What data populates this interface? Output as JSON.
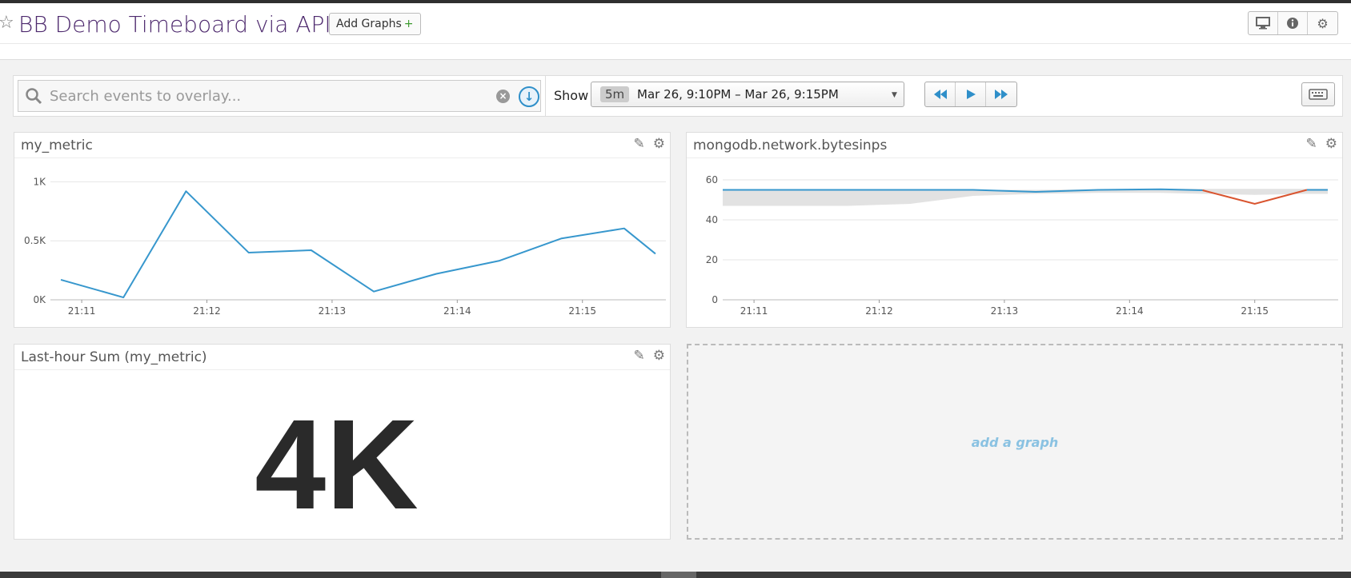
{
  "header": {
    "title": "BB Demo Timeboard via API",
    "add_graphs_label": "Add Graphs",
    "add_graphs_plus": "+",
    "icons": [
      "monitor-icon",
      "info-icon",
      "gear-icon"
    ]
  },
  "toolbar": {
    "search_placeholder": "Search events to overlay...",
    "show_label": "Show",
    "range_tag": "5m",
    "range_text": "Mar 26, 9:10PM – Mar 26, 9:15PM",
    "playback_icons": [
      "rewind-icon",
      "play-icon",
      "fast-forward-icon"
    ]
  },
  "panels": {
    "my_metric": {
      "title": "my_metric",
      "chart_data": {
        "type": "line",
        "x": [
          "21:10:50",
          "21:11:20",
          "21:11:50",
          "21:12:20",
          "21:12:50",
          "21:13:20",
          "21:13:50",
          "21:14:20",
          "21:14:50",
          "21:15:20",
          "21:15:35"
        ],
        "series": [
          {
            "values": [
              170,
              20,
              920,
              400,
              420,
              70,
              220,
              330,
              520,
              605,
              390
            ],
            "color": "#3797cd"
          }
        ],
        "yticks": [
          "0K",
          "0.5K",
          "1K"
        ],
        "ytick_values": [
          0,
          500,
          1000
        ],
        "xticks": [
          "21:11",
          "21:12",
          "21:13",
          "21:14",
          "21:15"
        ],
        "ylim": [
          0,
          1050
        ],
        "grid": true
      }
    },
    "mongodb": {
      "title": "mongodb.network.bytesinps",
      "chart_data": {
        "type": "line",
        "x": [
          "21:10:45",
          "21:11:15",
          "21:11:45",
          "21:12:15",
          "21:12:45",
          "21:13:15",
          "21:13:45",
          "21:14:15",
          "21:14:35",
          "21:15:00",
          "21:15:25",
          "21:15:35"
        ],
        "series": [
          {
            "values": [
              55,
              55,
              55,
              55,
              55,
              54,
              55,
              55.3,
              54.8,
              48,
              55,
              55
            ],
            "normal_color": "#3797cd",
            "anomaly_color": "#d9542f"
          }
        ],
        "band_upper": [
          55,
          55,
          55,
          55,
          55,
          55,
          55.3,
          55.5,
          55.5,
          55.5,
          55.5,
          55.5
        ],
        "band_lower": [
          47,
          47,
          47,
          48,
          52,
          53,
          53.5,
          53.5,
          53,
          52.5,
          53,
          53
        ],
        "yticks": [
          "0",
          "20",
          "40",
          "60"
        ],
        "ytick_values": [
          0,
          20,
          40,
          60
        ],
        "xticks": [
          "21:11",
          "21:12",
          "21:13",
          "21:14",
          "21:15"
        ],
        "ylim": [
          0,
          62
        ],
        "grid": true
      }
    },
    "sum": {
      "title": "Last-hour Sum (my_metric)",
      "value": "4K"
    },
    "add_graph_label": "add a graph"
  }
}
